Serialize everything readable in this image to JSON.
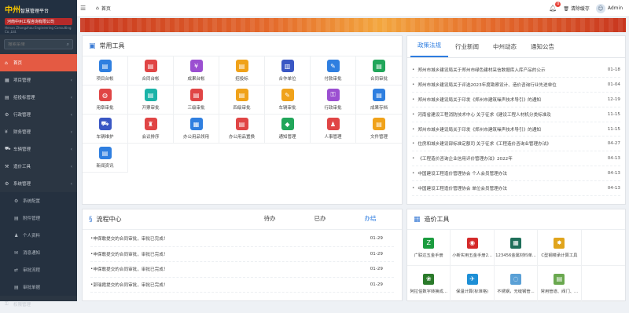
{
  "brand": {
    "title": "中州",
    "title_rest": "智慧管理平台",
    "company": "河南中州工程咨询有限公司",
    "company_en": "Henan Zhongzhou Engineering Consulting Co.,Ltd."
  },
  "search": {
    "placeholder": "搜索菜单"
  },
  "sidebar": {
    "items": [
      {
        "label": "首页",
        "icon": "home-icon",
        "active": true
      },
      {
        "label": "项目管理",
        "icon": "grid-icon"
      },
      {
        "label": "招投标管理",
        "icon": "doc-icon"
      },
      {
        "label": "行政管理",
        "icon": "gear-icon"
      },
      {
        "label": "财务管理",
        "icon": "money-icon"
      },
      {
        "label": "车辆管理",
        "icon": "car-icon"
      },
      {
        "label": "造价工具",
        "icon": "tool-icon"
      },
      {
        "label": "系统管理",
        "icon": "settings-icon"
      }
    ],
    "subitems": [
      {
        "label": "系统配置",
        "icon": "gear-icon"
      },
      {
        "label": "附件管理",
        "icon": "file-icon"
      },
      {
        "label": "个人资料",
        "icon": "user-icon"
      },
      {
        "label": "消息通知",
        "icon": "message-icon"
      },
      {
        "label": "审批流程",
        "icon": "flow-icon"
      },
      {
        "label": "审批单据",
        "icon": "form-icon"
      }
    ],
    "last_item": "权限管理"
  },
  "topbar": {
    "breadcrumb": "首页",
    "clear_cache": "清除缓存",
    "user": "Admin",
    "notifications": "0"
  },
  "tools": {
    "title": "常用工具",
    "items": [
      {
        "label": "项目台帐",
        "color": "c-blue",
        "glyph": "▤"
      },
      {
        "label": "合同台帐",
        "color": "c-red",
        "glyph": "▤"
      },
      {
        "label": "成果台帐",
        "color": "c-purple",
        "glyph": "¥"
      },
      {
        "label": "招投标",
        "color": "c-orange",
        "glyph": "▤"
      },
      {
        "label": "合作单位",
        "color": "c-navy",
        "glyph": "▥"
      },
      {
        "label": "付款审批",
        "color": "c-blue",
        "glyph": "✎"
      },
      {
        "label": "合同审批",
        "color": "c-green",
        "glyph": "▤"
      },
      {
        "label": "用章审批",
        "color": "c-red",
        "glyph": "◍"
      },
      {
        "label": "开票审批",
        "color": "c-teal",
        "glyph": "▤"
      },
      {
        "label": "三级审批",
        "color": "c-red",
        "glyph": "▤"
      },
      {
        "label": "四级审批",
        "color": "c-orange",
        "glyph": "▤"
      },
      {
        "label": "车辆审批",
        "color": "c-orange",
        "glyph": "✎"
      },
      {
        "label": "行政审批",
        "color": "c-purple",
        "glyph": "⚿"
      },
      {
        "label": "成果存档",
        "color": "c-blue",
        "glyph": "▤"
      },
      {
        "label": "车辆维护",
        "color": "c-navy",
        "glyph": "⛟"
      },
      {
        "label": "会议排序",
        "color": "c-red",
        "glyph": "♜"
      },
      {
        "label": "办公用品领用",
        "color": "c-blue",
        "glyph": "▦"
      },
      {
        "label": "办公用品置换",
        "color": "c-red",
        "glyph": "▤"
      },
      {
        "label": "通知管理",
        "color": "c-green",
        "glyph": "◆"
      },
      {
        "label": "人事管理",
        "color": "c-red",
        "glyph": "♟"
      },
      {
        "label": "文件管理",
        "color": "c-orange",
        "glyph": "▤"
      },
      {
        "label": "新闻资讯",
        "color": "c-blue",
        "glyph": "▤"
      }
    ]
  },
  "news": {
    "tabs": [
      "政策法规",
      "行业新闻",
      "中州动态",
      "通知公告"
    ],
    "active": 0,
    "items": [
      {
        "title": "郑州市城乡建设局关于郑州市绿色建材采信数据库入库产品的公示",
        "date": "01-18"
      },
      {
        "title": "郑州市城乡建设局关于评选2023年度勘察设计、造价咨询行业先进单位",
        "date": "01-04"
      },
      {
        "title": "郑州市城乡建设局关于印发《郑州市建筑噪声技术导引》的通知",
        "date": "12-19"
      },
      {
        "title": "河南省建设工程消防技术中心 关于征求《建设工程人材机分类标准及",
        "date": "11-15"
      },
      {
        "title": "郑州市城乡建设局关于印发《郑州市建筑噪声技术导引》的通知",
        "date": "11-15"
      },
      {
        "title": "住房和城乡建设部标准定额司 关于征求《工程造价咨询业管理办法》",
        "date": "04-27"
      },
      {
        "title": "《工程造价咨询企业信用评价管理办法》2022年",
        "date": "04-13"
      },
      {
        "title": "中国建设工程造价管理协会 个人会员管理办法",
        "date": "04-13"
      },
      {
        "title": "中国建设工程造价管理协会 单位会员管理办法",
        "date": "04-13"
      }
    ]
  },
  "flow": {
    "title": "流程中心",
    "tabs": [
      "待办",
      "已办",
      "办结"
    ],
    "active": 2,
    "items": [
      {
        "title": "申保歌提交的合同审批，审批已完成！",
        "date": "01-29"
      },
      {
        "title": "申保歌提交的合同审批，审批已完成！",
        "date": "01-29"
      },
      {
        "title": "申保歌提交的合同审批，审批已完成！",
        "date": "01-29"
      },
      {
        "title": "郭瑞霞提交的合同审批，审批已完成！",
        "date": "01-29"
      }
    ]
  },
  "cost": {
    "title": "造价工具",
    "items": [
      {
        "label": "广联达五金手册",
        "color": "#1b9c3f",
        "glyph": "Z"
      },
      {
        "label": "小新实用五金手册2...",
        "color": "#d42a2a",
        "glyph": "◉"
      },
      {
        "label": "123456金属材料单...",
        "color": "#1f6f5a",
        "glyph": "▦"
      },
      {
        "label": "C型钢楼承计算工具",
        "color": "#e0a41c",
        "glyph": "✸"
      },
      {
        "label": "",
        "color": "#ffffff",
        "glyph": ""
      },
      {
        "label": "阿拉伯数字转换成...",
        "color": "#2a7a2a",
        "glyph": "❀"
      },
      {
        "label": "保温计算(标准格)",
        "color": "#1d8fd6",
        "glyph": "✈"
      },
      {
        "label": "不锈钢，无缝钢管...",
        "color": "#5aa0d6",
        "glyph": "◌"
      },
      {
        "label": "常用管道、阀门、...",
        "color": "#6aa84f",
        "glyph": "▤"
      },
      {
        "label": "",
        "color": "#ffffff",
        "glyph": ""
      }
    ]
  }
}
